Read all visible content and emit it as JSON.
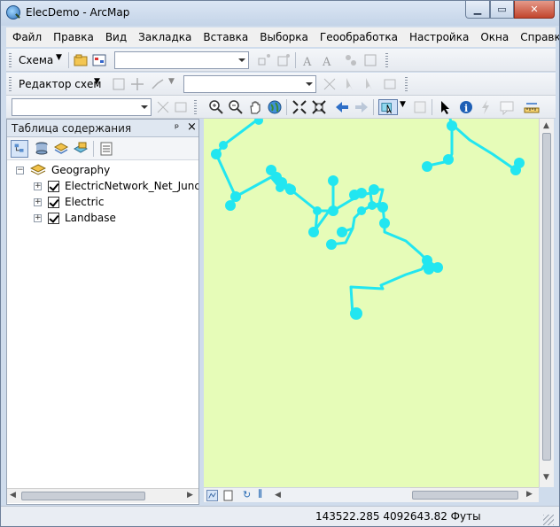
{
  "window": {
    "title": "ElecDemo - ArcMap"
  },
  "menu": [
    "Файл",
    "Правка",
    "Вид",
    "Закладка",
    "Вставка",
    "Выборка",
    "Геообработка",
    "Настройка",
    "Окна",
    "Справка"
  ],
  "toolbar1": {
    "schema_label": "Схема"
  },
  "toolbar2": {
    "schema_editor_label": "Редактор схем"
  },
  "toc": {
    "title": "Таблица содержания",
    "pin_glyph": "ᵖ",
    "close_glyph": "×",
    "group": "Geography",
    "layers": [
      {
        "label": "ElectricNetwork_Net_Junctions",
        "checked": true
      },
      {
        "label": "Electric",
        "checked": true
      },
      {
        "label": "Landbase",
        "checked": true
      }
    ]
  },
  "map": {
    "background": "#e6fcb8",
    "feature_color": "#22e6f0"
  },
  "status": {
    "coordinates": "143522.285  4092643.82 Футы"
  }
}
